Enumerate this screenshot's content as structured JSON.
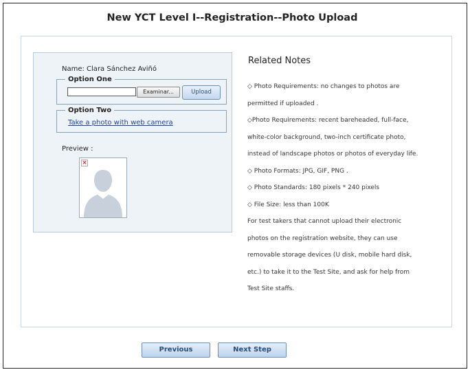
{
  "page": {
    "title": "New YCT Level I--Registration--Photo Upload"
  },
  "upload_panel": {
    "name_label": "Name:  Clara Sánchez Aviñó",
    "option_one_legend": "Option One",
    "file_input_value": "",
    "browse_label": "Examinar...",
    "upload_label": "Upload",
    "option_two_legend": "Option Two",
    "camera_link": "Take a photo with web camera",
    "preview_label": "Preview :"
  },
  "notes": {
    "title": "Related Notes",
    "lines": [
      "◇ Photo Requirements: no changes to photos are",
      "permitted if uploaded .",
      "◇Photo Requirements: recent bareheaded, full-face,",
      "white-color background, two-inch certificate photo,",
      "instead of landscape photos or photos of everyday life.",
      "◇ Photo Formats: JPG, GIF, PNG .",
      "◇ Photo Standards: 180 pixels * 240 pixels",
      "◇ File Size: less than 100K",
      "For test takers that cannot upload their electronic",
      "photos on the registration website, they can use",
      "removable storage devices (U disk, mobile hard disk,",
      "etc.) to take it to the Test Site, and ask for help from",
      "Test Site staffs."
    ]
  },
  "footer": {
    "previous_label": "Previous",
    "next_label": "Next Step"
  },
  "icons": {
    "broken_image": "broken-image-icon",
    "avatar": "avatar-silhouette"
  },
  "colors": {
    "panel_background": "#eef3f8",
    "button_text": "#2a4b73",
    "link": "#1a40a8"
  }
}
